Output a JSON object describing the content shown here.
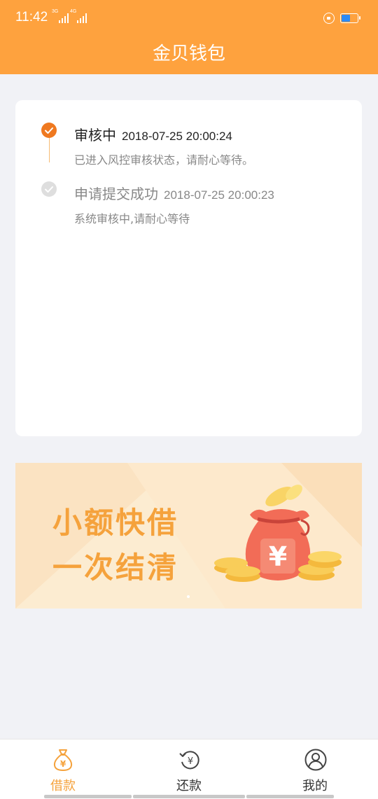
{
  "status_bar": {
    "time": "11:42",
    "signal1_type": "3G",
    "signal2_type": "4G",
    "battery_level": 0.6
  },
  "header": {
    "title": "金贝钱包"
  },
  "timeline": {
    "steps": [
      {
        "title": "审核中",
        "time": "2018-07-25 20:00:24",
        "desc": "已进入风控审核状态，请耐心等待。",
        "state": "active"
      },
      {
        "title": "申请提交成功",
        "time": "2018-07-25 20:00:23",
        "desc": "系统审核中,请耐心等待",
        "state": "done"
      }
    ]
  },
  "banner": {
    "line1": "小额快借",
    "line2": "一次结清",
    "bag_symbol": "¥",
    "page_count": 1,
    "current_page": 1
  },
  "tabbar": {
    "tabs": [
      {
        "label": "借款",
        "icon": "money-bag-icon",
        "active": true
      },
      {
        "label": "还款",
        "icon": "repay-icon",
        "active": false
      },
      {
        "label": "我的",
        "icon": "user-icon",
        "active": false
      }
    ]
  },
  "colors": {
    "brand": "#fea23e",
    "accent": "#ef7920",
    "banner_text": "#f5a23c"
  }
}
